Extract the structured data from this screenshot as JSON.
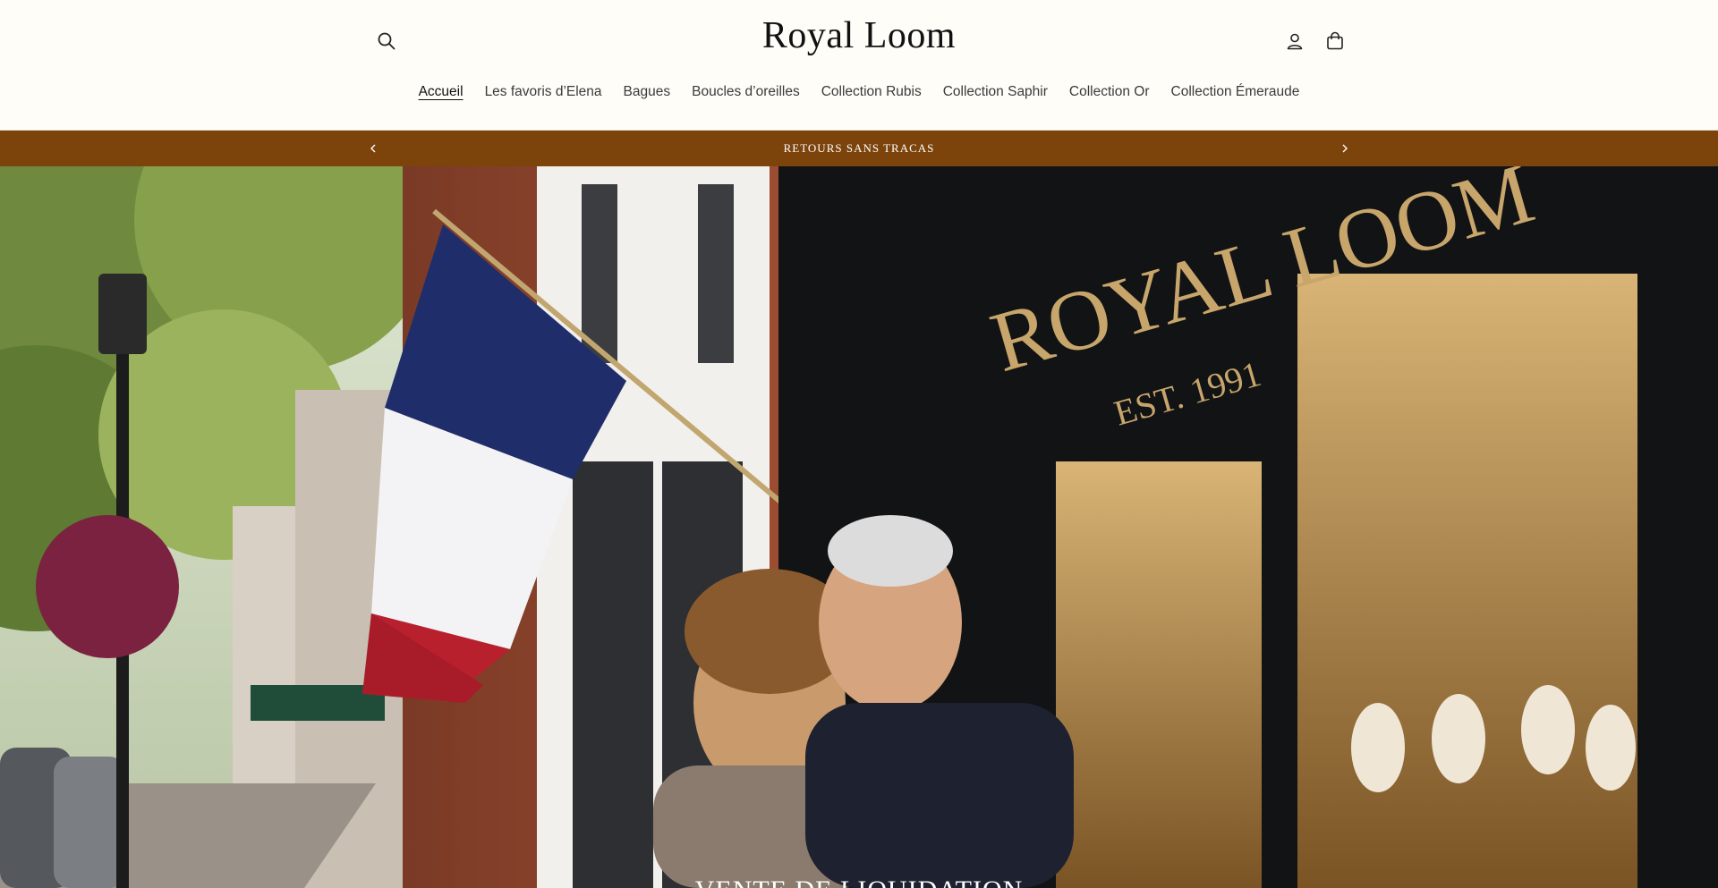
{
  "brand": {
    "name": "Royal Loom"
  },
  "nav": {
    "items": [
      {
        "label": "Accueil",
        "active": true
      },
      {
        "label": "Les favoris d’Elena"
      },
      {
        "label": "Bagues"
      },
      {
        "label": "Boucles d’oreilles"
      },
      {
        "label": "Collection Rubis"
      },
      {
        "label": "Collection Saphir"
      },
      {
        "label": "Collection Or"
      },
      {
        "label": "Collection Émeraude"
      }
    ]
  },
  "header_icons": {
    "search": "search-icon",
    "account": "user-icon",
    "cart": "cart-icon"
  },
  "announcement": {
    "text": "RETOURS SANS TRACAS",
    "background": "#7c430b"
  },
  "hero": {
    "heading": "VENTE DE LIQUIDATION",
    "sign_text": "ROYAL LOOM",
    "sign_subtext": "EST. 1991"
  }
}
